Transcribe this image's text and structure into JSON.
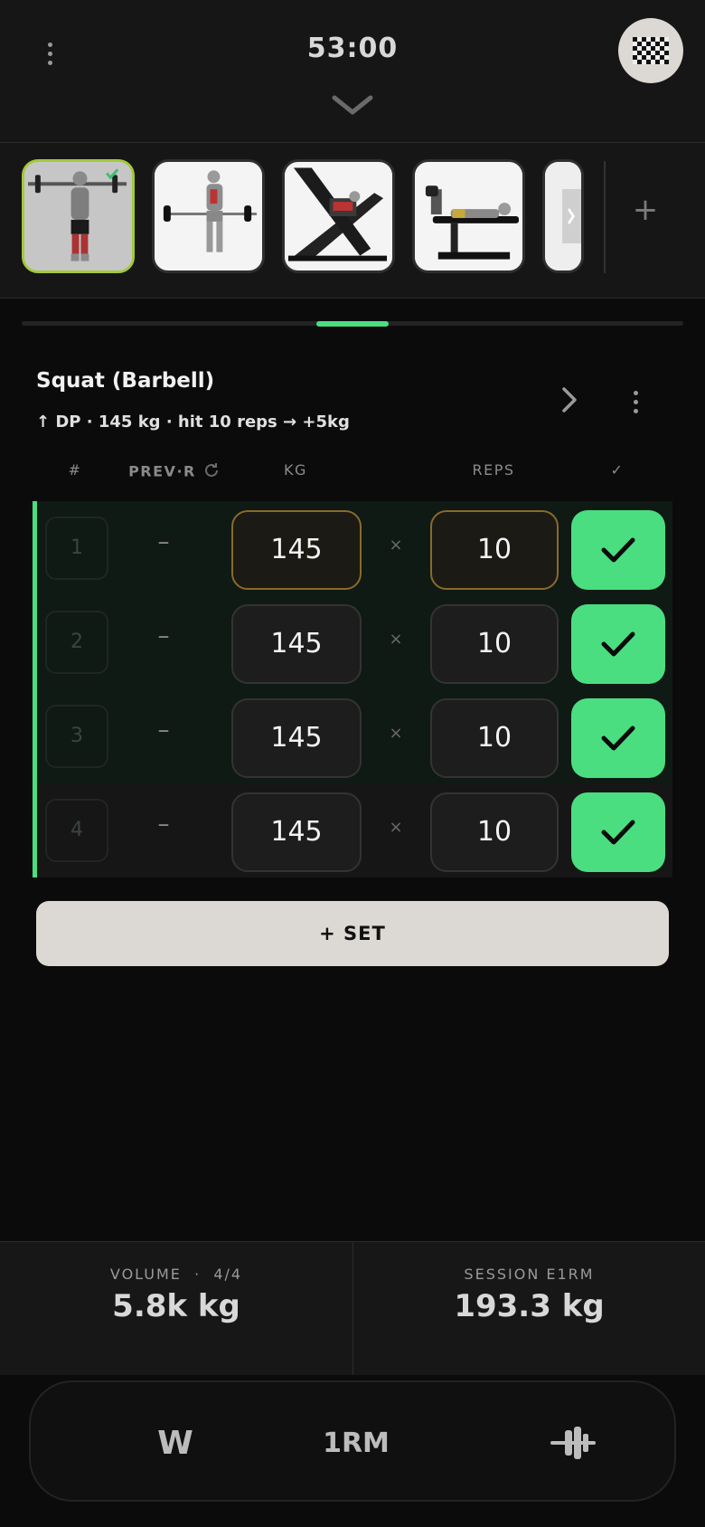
{
  "header": {
    "timer": "53:00"
  },
  "exercise_strip": {
    "add_label": "+",
    "thumbnails": [
      {
        "name": "squat-barbell-thumbnail",
        "active": true,
        "done": true
      },
      {
        "name": "deadlift-thumbnail",
        "active": false
      },
      {
        "name": "leg-press-thumbnail",
        "active": false
      },
      {
        "name": "leg-curl-thumbnail",
        "active": false
      },
      {
        "name": "next-exercise-thumbnail",
        "active": false
      }
    ]
  },
  "progress": {
    "current": 4,
    "total": 8
  },
  "exercise": {
    "title": "Squat (Barbell)",
    "hint": "↑ DP · 145 kg · hit 10 reps → +5kg"
  },
  "table": {
    "col_num": "#",
    "col_prev": "PREV·R",
    "col_kg": "KG",
    "col_reps": "REPS",
    "col_done": "✓",
    "times_symbol": "×",
    "sets": [
      {
        "num": "1",
        "prev": "–",
        "kg": "145",
        "reps": "10",
        "done": true
      },
      {
        "num": "2",
        "prev": "–",
        "kg": "145",
        "reps": "10",
        "done": true
      },
      {
        "num": "3",
        "prev": "–",
        "kg": "145",
        "reps": "10",
        "done": true
      },
      {
        "num": "4",
        "prev": "–",
        "kg": "145",
        "reps": "10",
        "done": true
      }
    ]
  },
  "add_set_label": "+ SET",
  "stats": {
    "volume_label": "VOLUME  ·  4/4",
    "volume_value": "5.8k kg",
    "e1rm_label": "SESSION E1RM",
    "e1rm_value": "193.3 kg"
  },
  "nav": {
    "w_label": "W",
    "onerm_label": "1RM",
    "plate_icon": "plate-calculator-icon"
  },
  "colors": {
    "accent": "#4ade80",
    "active_thumb_border": "#a4c83a",
    "highlight_border": "#8a6a2a"
  }
}
